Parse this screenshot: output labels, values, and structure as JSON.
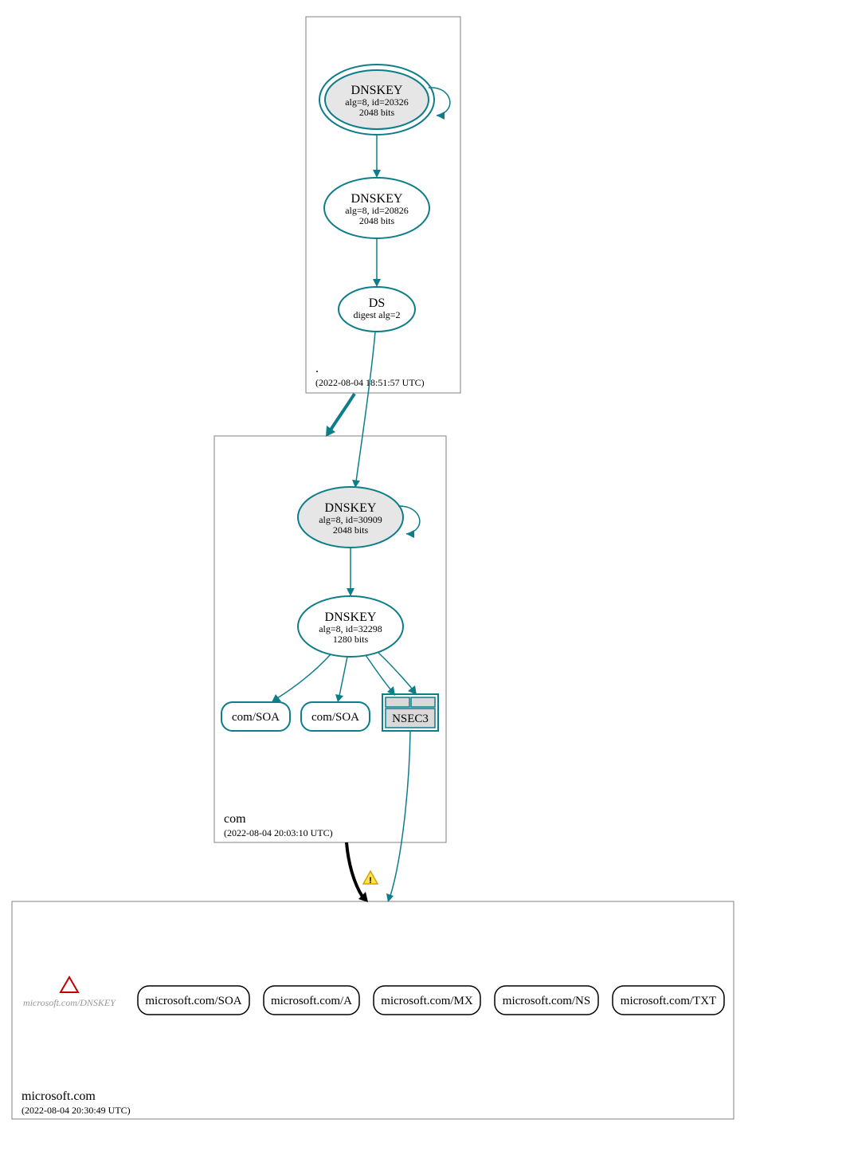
{
  "zones": {
    "root": {
      "label": ".",
      "timestamp": "(2022-08-04 18:51:57 UTC)",
      "ksk": {
        "title": "DNSKEY",
        "line2": "alg=8, id=20326",
        "line3": "2048 bits"
      },
      "zsk": {
        "title": "DNSKEY",
        "line2": "alg=8, id=20826",
        "line3": "2048 bits"
      },
      "ds": {
        "title": "DS",
        "line2": "digest alg=2"
      }
    },
    "com": {
      "label": "com",
      "timestamp": "(2022-08-04 20:03:10 UTC)",
      "ksk": {
        "title": "DNSKEY",
        "line2": "alg=8, id=30909",
        "line3": "2048 bits"
      },
      "zsk": {
        "title": "DNSKEY",
        "line2": "alg=8, id=32298",
        "line3": "1280 bits"
      },
      "soa1": "com/SOA",
      "soa2": "com/SOA",
      "nsec3": "NSEC3"
    },
    "microsoft": {
      "label": "microsoft.com",
      "timestamp": "(2022-08-04 20:30:49 UTC)",
      "missing_dnskey": "microsoft.com/DNSKEY",
      "rrs": [
        "microsoft.com/SOA",
        "microsoft.com/A",
        "microsoft.com/MX",
        "microsoft.com/NS",
        "microsoft.com/TXT"
      ]
    }
  }
}
